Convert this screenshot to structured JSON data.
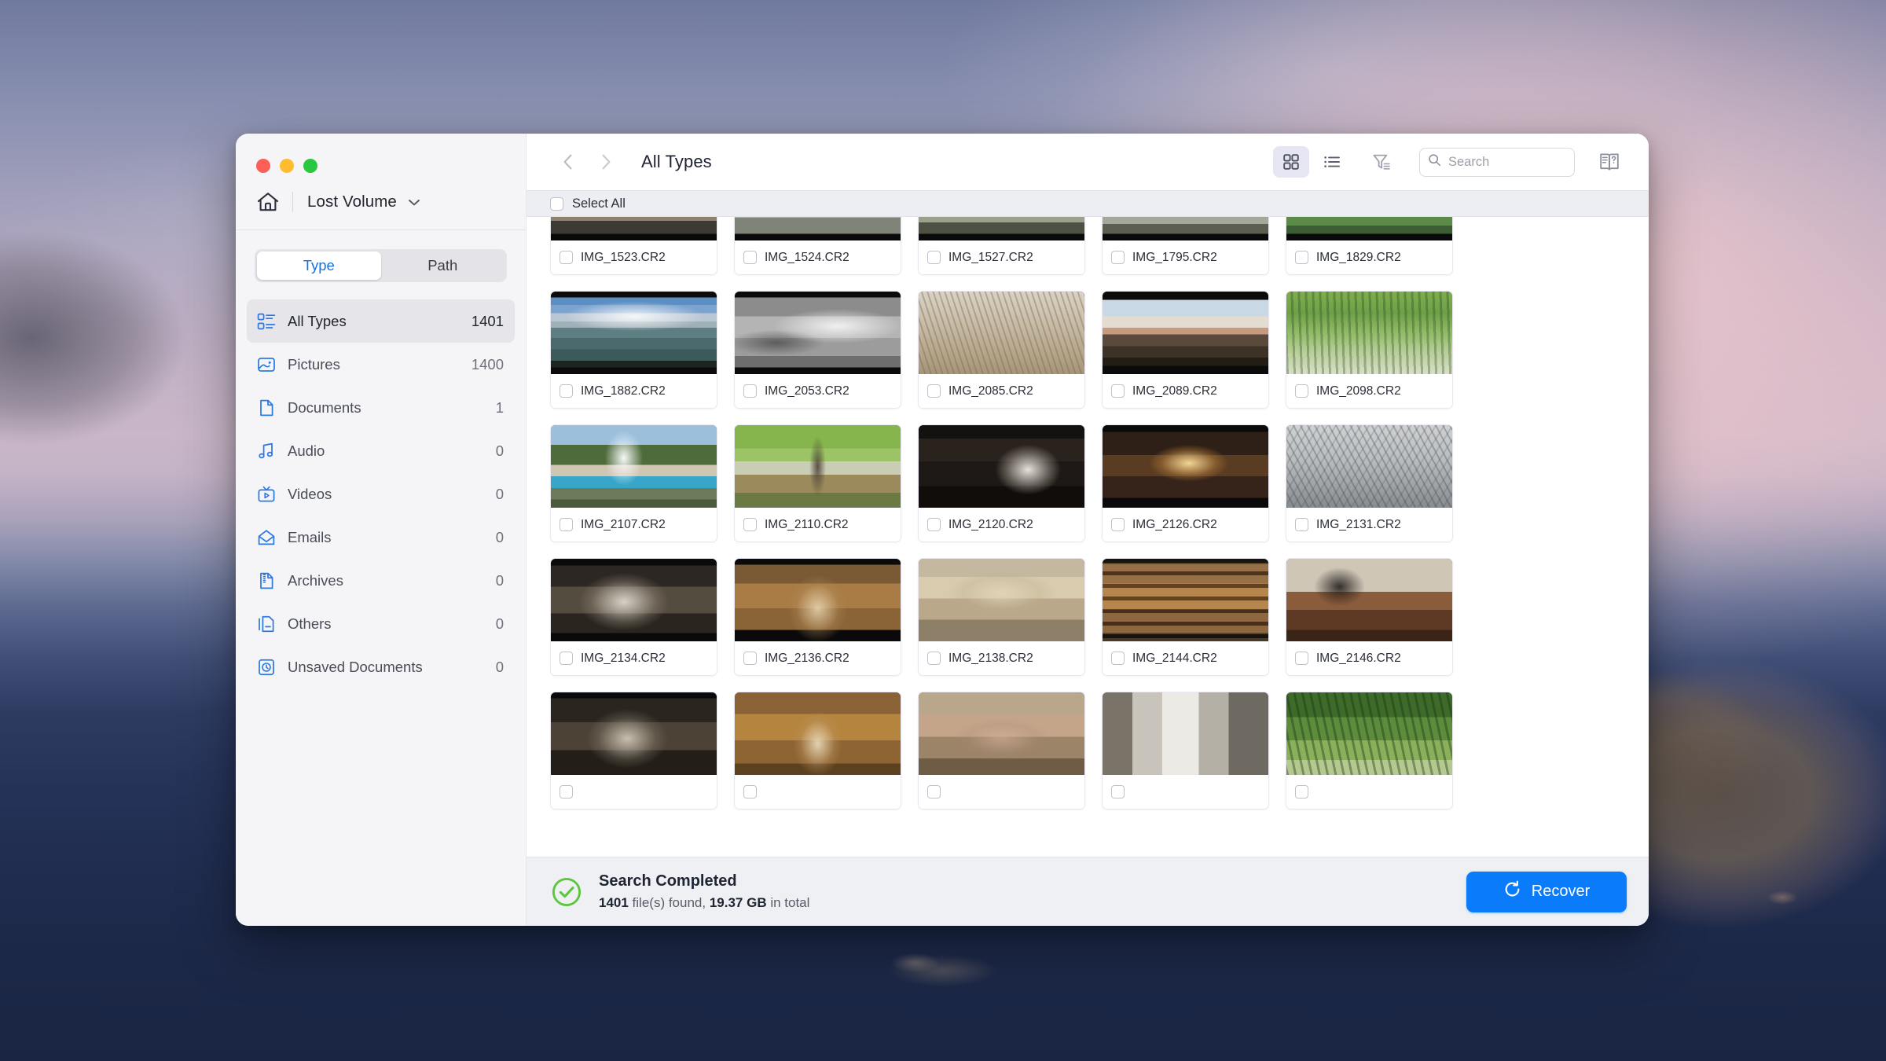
{
  "window": {
    "traffic_lights": [
      "close",
      "minimize",
      "maximize"
    ],
    "volume_name": "Lost Volume"
  },
  "sidebar": {
    "segmented": {
      "options": [
        "Type",
        "Path"
      ],
      "selected": "Type"
    },
    "items": [
      {
        "label": "All Types",
        "count": "1401",
        "icon": "all-types-icon",
        "active": true
      },
      {
        "label": "Pictures",
        "count": "1400",
        "icon": "pictures-icon",
        "active": false
      },
      {
        "label": "Documents",
        "count": "1",
        "icon": "documents-icon",
        "active": false
      },
      {
        "label": "Audio",
        "count": "0",
        "icon": "audio-icon",
        "active": false
      },
      {
        "label": "Videos",
        "count": "0",
        "icon": "videos-icon",
        "active": false
      },
      {
        "label": "Emails",
        "count": "0",
        "icon": "emails-icon",
        "active": false
      },
      {
        "label": "Archives",
        "count": "0",
        "icon": "archives-icon",
        "active": false
      },
      {
        "label": "Others",
        "count": "0",
        "icon": "others-icon",
        "active": false
      },
      {
        "label": "Unsaved Documents",
        "count": "0",
        "icon": "unsaved-documents-icon",
        "active": false
      }
    ]
  },
  "toolbar": {
    "title": "All Types",
    "back_icon": "chevron-left-icon",
    "forward_icon": "chevron-right-icon",
    "grid_view_icon": "grid-view-icon",
    "list_view_icon": "list-view-icon",
    "filter_icon": "filter-icon",
    "help_icon": "manual-book-icon",
    "active_view": "grid"
  },
  "search": {
    "value": "",
    "placeholder": "Search",
    "icon": "search-icon"
  },
  "select_all": {
    "label": "Select All",
    "checked": false
  },
  "files": [
    {
      "name": "IMG_1523.CR2",
      "checked": false,
      "thumb": "t1523"
    },
    {
      "name": "IMG_1524.CR2",
      "checked": false,
      "thumb": "t1524"
    },
    {
      "name": "IMG_1527.CR2",
      "checked": false,
      "thumb": "t1527"
    },
    {
      "name": "IMG_1795.CR2",
      "checked": false,
      "thumb": "t1795"
    },
    {
      "name": "IMG_1829.CR2",
      "checked": false,
      "thumb": "t1829"
    },
    {
      "name": "IMG_1882.CR2",
      "checked": false,
      "thumb": "t1882"
    },
    {
      "name": "IMG_2053.CR2",
      "checked": false,
      "thumb": "t2053"
    },
    {
      "name": "IMG_2085.CR2",
      "checked": false,
      "thumb": "t2085"
    },
    {
      "name": "IMG_2089.CR2",
      "checked": false,
      "thumb": "t2089"
    },
    {
      "name": "IMG_2098.CR2",
      "checked": false,
      "thumb": "t2098"
    },
    {
      "name": "IMG_2107.CR2",
      "checked": false,
      "thumb": "t2107"
    },
    {
      "name": "IMG_2110.CR2",
      "checked": false,
      "thumb": "t2110"
    },
    {
      "name": "IMG_2120.CR2",
      "checked": false,
      "thumb": "t2120"
    },
    {
      "name": "IMG_2126.CR2",
      "checked": false,
      "thumb": "t2126"
    },
    {
      "name": "IMG_2131.CR2",
      "checked": false,
      "thumb": "t2131"
    },
    {
      "name": "IMG_2134.CR2",
      "checked": false,
      "thumb": "t2134"
    },
    {
      "name": "IMG_2136.CR2",
      "checked": false,
      "thumb": "t2136"
    },
    {
      "name": "IMG_2138.CR2",
      "checked": false,
      "thumb": "t2138"
    },
    {
      "name": "IMG_2144.CR2",
      "checked": false,
      "thumb": "t2144"
    },
    {
      "name": "IMG_2146.CR2",
      "checked": false,
      "thumb": "t2146"
    },
    {
      "name": "",
      "checked": false,
      "thumb": "t2150"
    },
    {
      "name": "",
      "checked": false,
      "thumb": "t2151"
    },
    {
      "name": "",
      "checked": false,
      "thumb": "t2152"
    },
    {
      "name": "",
      "checked": false,
      "thumb": "t2153"
    },
    {
      "name": "",
      "checked": false,
      "thumb": "t2154"
    }
  ],
  "status": {
    "icon": "success-check-icon",
    "title": "Search Completed",
    "count": "1401",
    "found_text": " file(s) found, ",
    "size": "19.37 GB",
    "total_text": " in total"
  },
  "recover": {
    "label": "Recover",
    "icon": "recover-refresh-icon",
    "color": "#0a7cfb"
  },
  "colors": {
    "accent_blue": "#0a7cfb",
    "sidebar_bg": "#f5f5f8",
    "status_bg": "#eef0f4",
    "success_green": "#5cc63d",
    "icon_blue": "#2a7ae2"
  }
}
